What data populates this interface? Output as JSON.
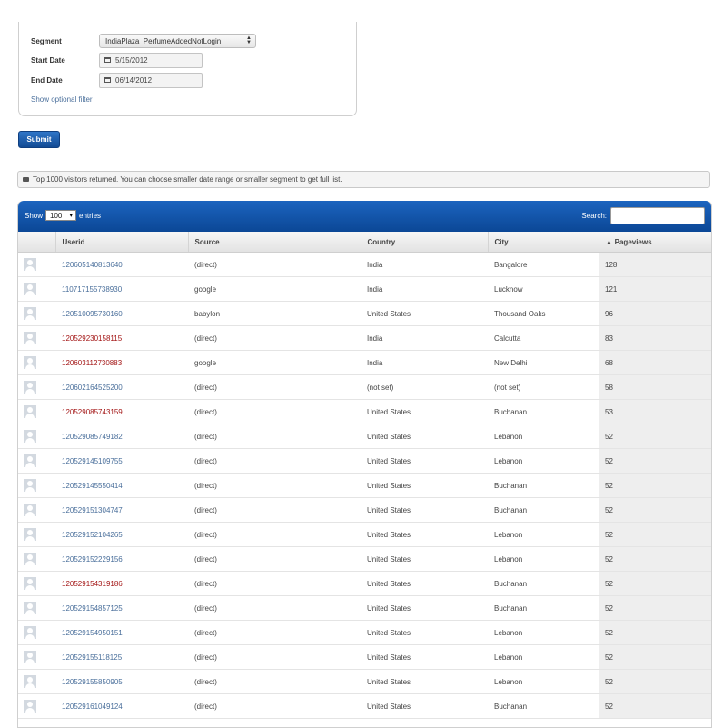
{
  "form": {
    "segment_label": "Segment",
    "segment_value": "IndiaPlaza_PerfumeAddedNotLogin",
    "start_label": "Start Date",
    "start_value": "5/15/2012",
    "end_label": "End Date",
    "end_value": "06/14/2012",
    "optional_filter": "Show optional filter",
    "submit": "Submit"
  },
  "notice": "Top 1000 visitors returned. You can choose smaller date range or smaller segment to get full list.",
  "table": {
    "show_label": "Show",
    "length_value": "100",
    "entries_label": "entries",
    "search_label": "Search:",
    "columns": [
      "",
      "Userid",
      "Source",
      "Country",
      "City",
      "▲ Pageviews"
    ],
    "rows": [
      {
        "userid": "120605140813640",
        "source": "(direct)",
        "country": "India",
        "city": "Bangalore",
        "pageviews": "128",
        "highlight": false
      },
      {
        "userid": "110717155738930",
        "source": "google",
        "country": "India",
        "city": "Lucknow",
        "pageviews": "121",
        "highlight": false
      },
      {
        "userid": "120510095730160",
        "source": "babylon",
        "country": "United States",
        "city": "Thousand Oaks",
        "pageviews": "96",
        "highlight": false
      },
      {
        "userid": "120529230158115",
        "source": "(direct)",
        "country": "India",
        "city": "Calcutta",
        "pageviews": "83",
        "highlight": true
      },
      {
        "userid": "120603112730883",
        "source": "google",
        "country": "India",
        "city": "New Delhi",
        "pageviews": "68",
        "highlight": true
      },
      {
        "userid": "120602164525200",
        "source": "(direct)",
        "country": "(not set)",
        "city": "(not set)",
        "pageviews": "58",
        "highlight": false
      },
      {
        "userid": "120529085743159",
        "source": "(direct)",
        "country": "United States",
        "city": "Buchanan",
        "pageviews": "53",
        "highlight": true
      },
      {
        "userid": "120529085749182",
        "source": "(direct)",
        "country": "United States",
        "city": "Lebanon",
        "pageviews": "52",
        "highlight": false
      },
      {
        "userid": "120529145109755",
        "source": "(direct)",
        "country": "United States",
        "city": "Lebanon",
        "pageviews": "52",
        "highlight": false
      },
      {
        "userid": "120529145550414",
        "source": "(direct)",
        "country": "United States",
        "city": "Buchanan",
        "pageviews": "52",
        "highlight": false
      },
      {
        "userid": "120529151304747",
        "source": "(direct)",
        "country": "United States",
        "city": "Buchanan",
        "pageviews": "52",
        "highlight": false
      },
      {
        "userid": "120529152104265",
        "source": "(direct)",
        "country": "United States",
        "city": "Lebanon",
        "pageviews": "52",
        "highlight": false
      },
      {
        "userid": "120529152229156",
        "source": "(direct)",
        "country": "United States",
        "city": "Lebanon",
        "pageviews": "52",
        "highlight": false
      },
      {
        "userid": "120529154319186",
        "source": "(direct)",
        "country": "United States",
        "city": "Buchanan",
        "pageviews": "52",
        "highlight": true
      },
      {
        "userid": "120529154857125",
        "source": "(direct)",
        "country": "United States",
        "city": "Buchanan",
        "pageviews": "52",
        "highlight": false
      },
      {
        "userid": "120529154950151",
        "source": "(direct)",
        "country": "United States",
        "city": "Lebanon",
        "pageviews": "52",
        "highlight": false
      },
      {
        "userid": "120529155118125",
        "source": "(direct)",
        "country": "United States",
        "city": "Lebanon",
        "pageviews": "52",
        "highlight": false
      },
      {
        "userid": "120529155850905",
        "source": "(direct)",
        "country": "United States",
        "city": "Lebanon",
        "pageviews": "52",
        "highlight": false
      },
      {
        "userid": "120529161049124",
        "source": "(direct)",
        "country": "United States",
        "city": "Buchanan",
        "pageviews": "52",
        "highlight": false
      }
    ]
  },
  "colors": {
    "link": "#4a6f9b",
    "link_visited": "#a31515",
    "header_blue": "#0b4796"
  }
}
